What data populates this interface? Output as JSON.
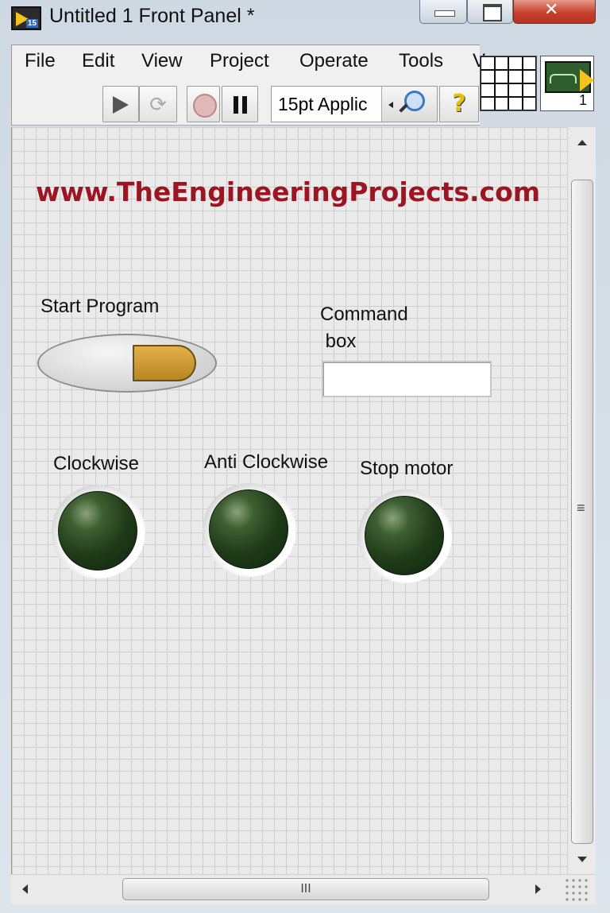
{
  "window": {
    "title": "Untitled 1 Front Panel *",
    "app_icon_num": "15"
  },
  "menubar": {
    "items": [
      "File",
      "Edit",
      "View",
      "Project",
      "Operate",
      "Tools",
      "V"
    ]
  },
  "toolbar": {
    "font_select": "15pt Applic",
    "help_label": "?"
  },
  "icon_pane": {
    "number": "1"
  },
  "panel": {
    "website": "www.TheEngineeringProjects.com",
    "start_label": "Start  Program",
    "command_label_line1": "Command",
    "command_label_line2": " box",
    "command_value": "",
    "led_labels": [
      "Clockwise",
      "Anti Clockwise",
      "Stop motor"
    ]
  },
  "hscroll": {
    "thumb_grip": "III"
  },
  "colors": {
    "website_text": "#9c1522",
    "led_off": "#1f3b18",
    "toggle_knob": "#c99a34"
  }
}
